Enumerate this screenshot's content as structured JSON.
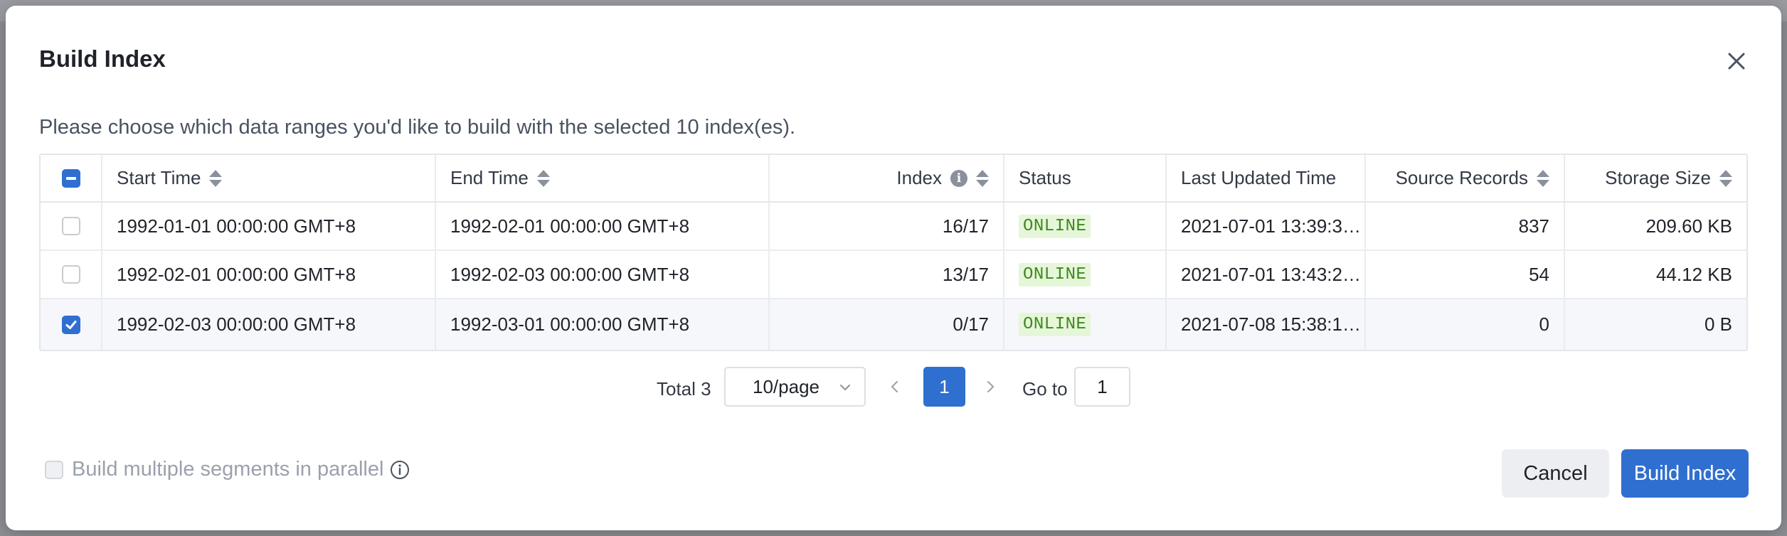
{
  "modal": {
    "title": "Build Index",
    "description": "Please choose which data ranges you'd like to build with the selected 10 index(es)."
  },
  "table": {
    "columns": {
      "start_time": "Start Time",
      "end_time": "End Time",
      "index": "Index",
      "status": "Status",
      "last_updated": "Last Updated Time",
      "source_records": "Source Records",
      "storage_size": "Storage Size"
    },
    "rows": [
      {
        "start_time": "1992-01-01 00:00:00 GMT+8",
        "end_time": "1992-02-01 00:00:00 GMT+8",
        "index": "16/17",
        "status": "ONLINE",
        "last_updated": "2021-07-01 13:39:3…",
        "source_records": "837",
        "storage_size": "209.60 KB",
        "checked": false
      },
      {
        "start_time": "1992-02-01 00:00:00 GMT+8",
        "end_time": "1992-02-03 00:00:00 GMT+8",
        "index": "13/17",
        "status": "ONLINE",
        "last_updated": "2021-07-01 13:43:2…",
        "source_records": "54",
        "storage_size": "44.12 KB",
        "checked": false
      },
      {
        "start_time": "1992-02-03 00:00:00 GMT+8",
        "end_time": "1992-03-01 00:00:00 GMT+8",
        "index": "0/17",
        "status": "ONLINE",
        "last_updated": "2021-07-08 15:38:1…",
        "source_records": "0",
        "storage_size": "0 B",
        "checked": true
      }
    ]
  },
  "pagination": {
    "total": "Total 3",
    "page_size": "10/page",
    "current_page": "1",
    "goto_label": "Go to",
    "goto_value": "1"
  },
  "footer": {
    "parallel_label": "Build multiple segments in parallel",
    "cancel_label": "Cancel",
    "build_label": "Build Index"
  },
  "colors": {
    "primary": "#2f6fd0",
    "status_online_bg": "#e6f6d9",
    "status_online_text": "#3e8a1c"
  },
  "icons": [
    "close-icon",
    "sort-icon",
    "info-icon",
    "chevron-down-icon",
    "chevron-left-icon",
    "chevron-right-icon",
    "info-outline-icon",
    "check-icon"
  ]
}
